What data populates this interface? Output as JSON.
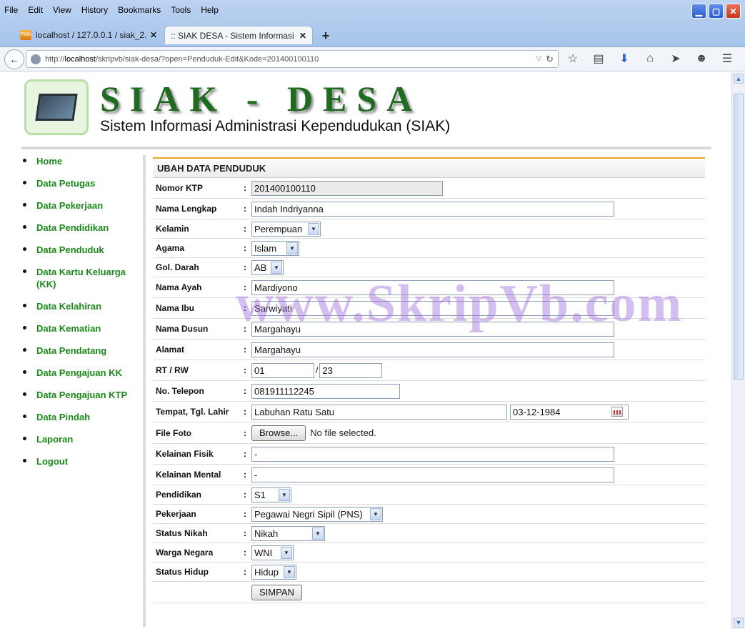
{
  "browser": {
    "menu": [
      "File",
      "Edit",
      "View",
      "History",
      "Bookmarks",
      "Tools",
      "Help"
    ],
    "tabs": [
      {
        "label": "localhost / 127.0.0.1 / siak_2...",
        "icon": "PMA"
      },
      {
        "label": ":: SIAK DESA - Sistem Informasi A..."
      }
    ],
    "url_prefix": "http://",
    "url_host": "localhost",
    "url_path": "/skripvb/siak-desa/?open=Penduduk-Edit&Kode=201400100110"
  },
  "header": {
    "title": "SIAK - DESA",
    "subtitle": "Sistem Informasi Administrasi Kependudukan (SIAK)"
  },
  "sidebar": {
    "items": [
      "Home",
      "Data Petugas",
      "Data Pekerjaan",
      "Data Pendidikan",
      "Data Penduduk",
      "Data Kartu Keluarga (KK)",
      "Data Kelahiran",
      "Data Kematian",
      "Data Pendatang",
      "Data Pengajuan KK",
      "Data Pengajuan KTP",
      "Data Pindah",
      "Laporan",
      "Logout"
    ]
  },
  "form": {
    "heading": "UBAH DATA PENDUDUK",
    "colon": ":",
    "labels": {
      "ktp": "Nomor KTP",
      "nama": "Nama Lengkap",
      "kelamin": "Kelamin",
      "agama": "Agama",
      "darah": "Gol. Darah",
      "ayah": "Nama Ayah",
      "ibu": "Nama Ibu",
      "dusun": "Nama Dusun",
      "alamat": "Alamat",
      "rtrw": "RT / RW",
      "telepon": "No. Telepon",
      "ttl": "Tempat, Tgl. Lahir",
      "foto": "File Foto",
      "fisik": "Kelainan Fisik",
      "mental": "Kelainan Mental",
      "pendidikan": "Pendidikan",
      "pekerjaan": "Pekerjaan",
      "nikah": "Status Nikah",
      "warga": "Warga Negara",
      "hidup": "Status Hidup"
    },
    "values": {
      "ktp": "201400100110",
      "nama": "Indah Indriyanna",
      "kelamin": "Perempuan",
      "agama": "Islam",
      "darah": "AB",
      "ayah": "Mardiyono",
      "ibu": "Sarwiyati",
      "dusun": "Margahayu",
      "alamat": "Margahayu",
      "rt": "01",
      "rw_sep": "/",
      "rw": "23",
      "telepon": "081911112245",
      "tempat": "Labuhan Ratu Satu",
      "tgl": "03-12-1984",
      "fisik": "-",
      "mental": "-",
      "pendidikan": "S1",
      "pekerjaan": "Pegawai Negri Sipil (PNS)",
      "nikah": "Nikah",
      "warga": "WNI",
      "hidup": "Hidup"
    },
    "browse_label": "Browse...",
    "no_file": "No file selected.",
    "submit": "SIMPAN"
  },
  "watermark": "www.SkripVb.com"
}
